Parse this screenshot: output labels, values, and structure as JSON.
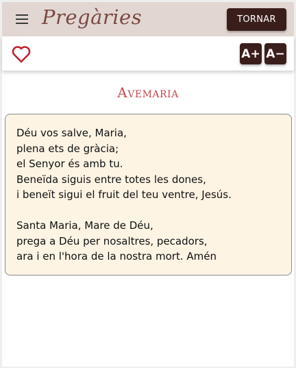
{
  "appbar": {
    "title": "Pregàries",
    "back_label": "TORNAR",
    "menu_icon": "hamburger-menu-icon"
  },
  "toolbar": {
    "favorite_icon": "heart-outline-icon",
    "font_increase_label": "A+",
    "font_decrease_label": "A−"
  },
  "prayer": {
    "title": "Avemaria",
    "stanzas": [
      {
        "lines": [
          "Déu vos salve, Maria,",
          "plena ets de gràcia;",
          "el Senyor és amb tu.",
          "Beneïda siguis entre totes les dones,",
          "i beneït sigui el fruit del teu ventre, Jesús."
        ]
      },
      {
        "lines": [
          "Santa Maria, Mare de Déu,",
          "prega a Déu per nosaltres, pecadors,",
          "ara i en l'hora de la nostra mort. Amén"
        ]
      }
    ]
  },
  "colors": {
    "appbar_bg": "#e2d6d3",
    "button_bg": "#3a1e1c",
    "title_accent": "#c44a50",
    "card_bg": "#fdf4e4",
    "heart": "#c4202c"
  }
}
